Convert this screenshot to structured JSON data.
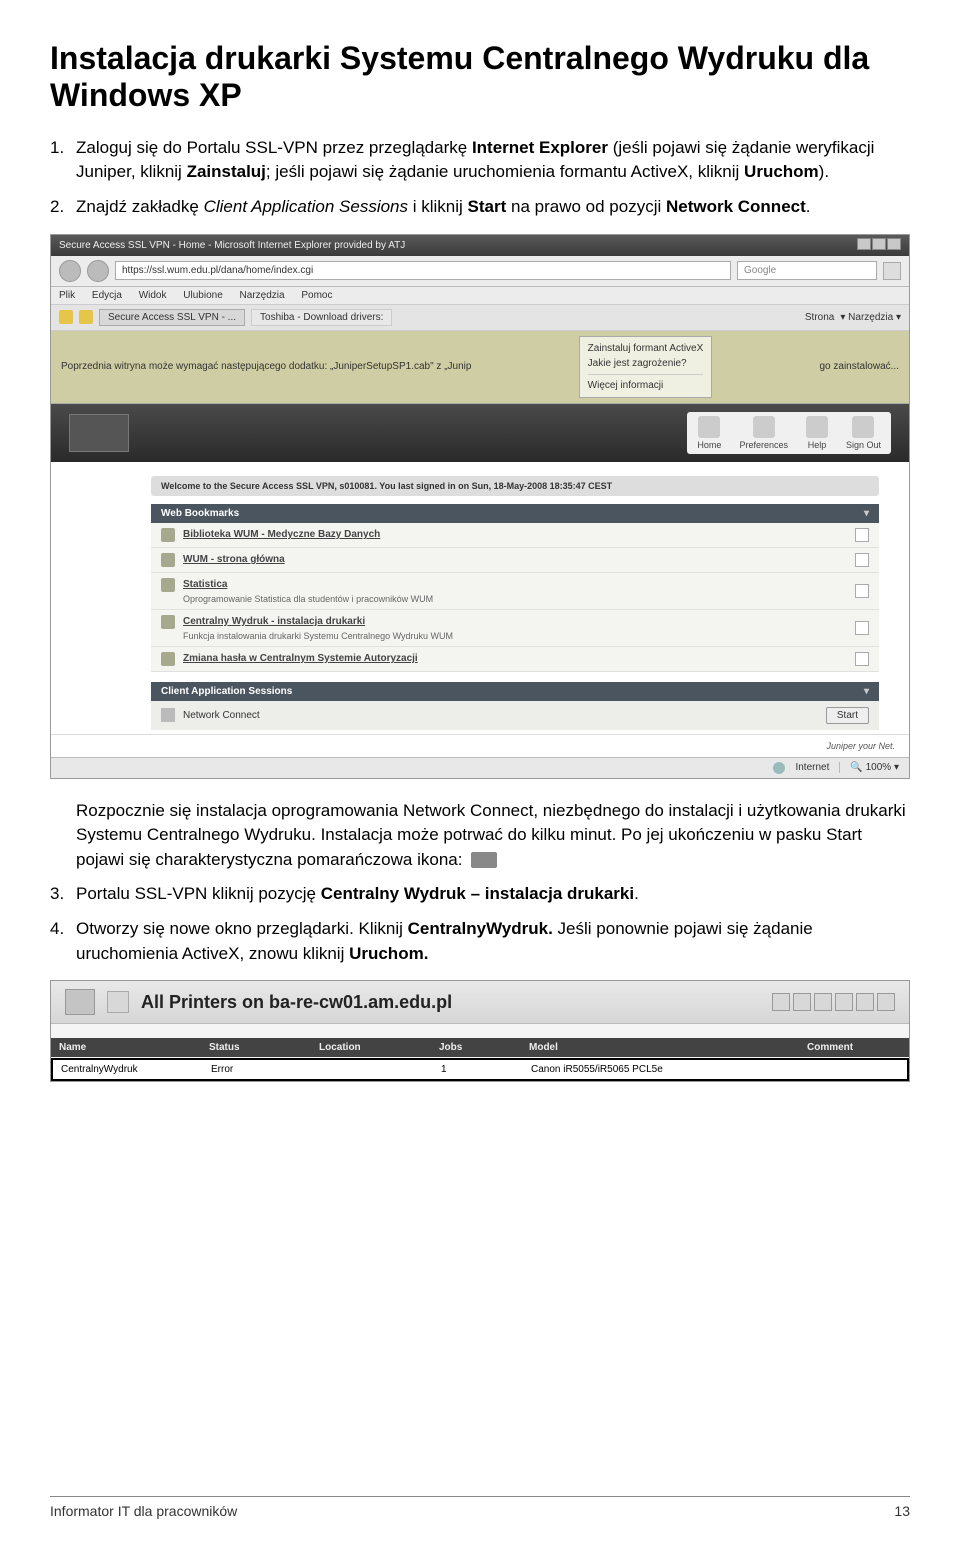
{
  "title": "Instalacja drukarki Systemu Centralnego Wydruku dla Windows XP",
  "steps": {
    "s1": {
      "num": "1.",
      "text_before": "Zaloguj się do Portalu SSL-VPN przez przeglądarkę ",
      "b1": "Internet Explorer",
      "t2": " (jeśli pojawi się żądanie weryfikacji Juniper, kliknij ",
      "b2": "Zainstaluj",
      "t3": "; jeśli pojawi się żądanie uruchomienia formantu ActiveX, kliknij ",
      "b3": "Uruchom",
      "t4": ")."
    },
    "s2": {
      "num": "2.",
      "t1": "Znajdź zakładkę ",
      "i1": "Client Application Sessions",
      "t2": " i kliknij ",
      "b1": "Start",
      "t3": " na prawo od pozycji ",
      "b2": "Network Connect",
      "t4": "."
    },
    "after": {
      "p1a": "Rozpocznie się instalacja oprogramowania Network Connect, niezbędnego do instalacji i użytkowania drukarki Systemu Centralnego Wydruku. Instalacja może potrwać do kilku minut. Po jej ukończeniu w pasku Start pojawi się charakterystyczna pomarańczowa ikona:"
    },
    "s3": {
      "num": "3.",
      "t1": " Portalu SSL-VPN kliknij pozycję ",
      "b1": "Centralny Wydruk – instalacja drukarki",
      "t2": "."
    },
    "s4": {
      "num": "4.",
      "t1": "Otworzy się nowe okno przeglądarki. Kliknij ",
      "b1": "CentralnyWydruk.",
      "t2": " Jeśli ponownie pojawi się żądanie uruchomienia ActiveX, znowu kliknij ",
      "b2": "Uruchom.",
      "t3": ""
    }
  },
  "ss1": {
    "titlebar": "Secure Access SSL VPN - Home - Microsoft Internet Explorer provided by ATJ",
    "url": "https://ssl.wum.edu.pl/dana/home/index.cgi",
    "search": "Google",
    "menu": [
      "Plik",
      "Edycja",
      "Widok",
      "Ulubione",
      "Narzędzia",
      "Pomoc"
    ],
    "tab1": "Secure Access SSL VPN - ...",
    "tab2": "Toshiba - Download drivers:",
    "tools": [
      "Strona",
      "Narzędzia"
    ],
    "infobar_left": "Poprzednia witryna może wymagać następującego dodatku: „JuniperSetupSP1.cab\" z „Junip",
    "infobar_right": "go zainstalować...",
    "popup": [
      "Zainstaluj formant ActiveX",
      "Jakie jest zagrożenie?",
      "Więcej informacji"
    ],
    "hicons": [
      "Home",
      "Preferences",
      "Help",
      "Sign Out"
    ],
    "welcome": "Welcome to the Secure Access SSL VPN, s010081.  You last signed in on  Sun, 18-May-2008 18:35:47 CEST",
    "sec_bm": "Web Bookmarks",
    "bookmarks": [
      {
        "t": "Biblioteka WUM - Medyczne Bazy Danych",
        "s": ""
      },
      {
        "t": "WUM - strona główna",
        "s": ""
      },
      {
        "t": "Statistica",
        "s": "Oprogramowanie Statistica dla studentów i pracowników WUM"
      },
      {
        "t": "Centralny Wydruk - instalacja drukarki",
        "s": "Funkcja instalowania drukarki Systemu Centralnego Wydruku WUM"
      },
      {
        "t": "Zmiana hasła w Centralnym Systemie Autoryzacji",
        "s": ""
      }
    ],
    "sec_cas": "Client Application Sessions",
    "cas_item": "Network Connect",
    "cas_btn": "Start",
    "footer": "Juniper  your  Net.",
    "status_zone": "Internet",
    "status_zoom": "100%"
  },
  "ss2": {
    "title": "All Printers on ba-re-cw01.am.edu.pl",
    "cols": [
      "Name",
      "Status",
      "Location",
      "Jobs",
      "Model",
      "Comment"
    ],
    "row": [
      "CentralnyWydruk",
      "Error",
      "",
      "1",
      "Canon iR5055/iR5065 PCL5e",
      ""
    ]
  },
  "footer": {
    "left": "Informator IT dla pracowników",
    "right": "13"
  }
}
